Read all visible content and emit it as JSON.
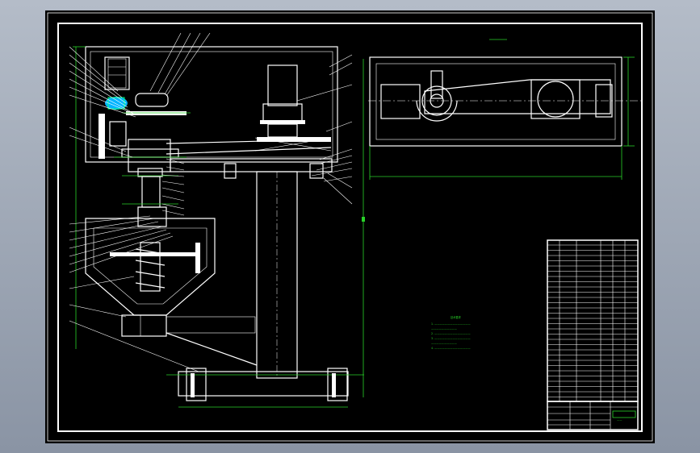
{
  "colors": {
    "background_outer": "#a0a8b4",
    "drawing_background": "#000000",
    "linework": "#ffffff",
    "dimension_lines": "#28d228",
    "highlight_part": "#00b4ff"
  },
  "notes": {
    "heading": "技术要求",
    "lines": [
      "1.  ——————————————",
      "     ——————————",
      "2.  ——————————————",
      "3.  ——————————————",
      "     ——————————",
      "4.  ——————————————"
    ]
  },
  "title_block": {
    "drawing_number": "——"
  }
}
